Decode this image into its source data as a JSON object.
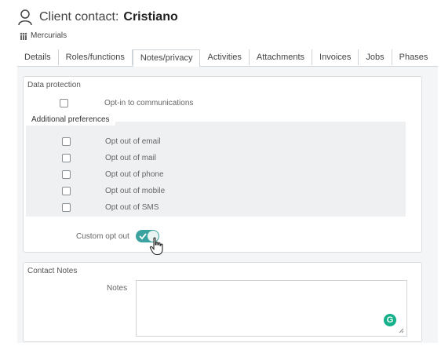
{
  "header": {
    "title_label": "Client contact:",
    "name": "Cristiano",
    "org": "Mercurials"
  },
  "tabs": [
    {
      "label": "Details"
    },
    {
      "label": "Roles/functions"
    },
    {
      "label": "Notes/privacy"
    },
    {
      "label": "Activities"
    },
    {
      "label": "Attachments"
    },
    {
      "label": "Invoices"
    },
    {
      "label": "Jobs"
    },
    {
      "label": "Phases"
    }
  ],
  "data_protection": {
    "legend": "Data protection",
    "optin_label": "Opt-in to communications",
    "additional": {
      "legend": "Additional preferences",
      "items": [
        {
          "label": "Opt out of email"
        },
        {
          "label": "Opt out of mail"
        },
        {
          "label": "Opt out of phone"
        },
        {
          "label": "Opt out of mobile"
        },
        {
          "label": "Opt out of SMS"
        }
      ]
    },
    "custom_opt_out_label": "Custom opt out",
    "custom_opt_out_on": true
  },
  "contact_notes": {
    "legend": "Contact Notes",
    "notes_label": "Notes",
    "notes_value": ""
  },
  "colors": {
    "toggle_accent": "#3aa39f",
    "grammarly": "#16b08a"
  }
}
